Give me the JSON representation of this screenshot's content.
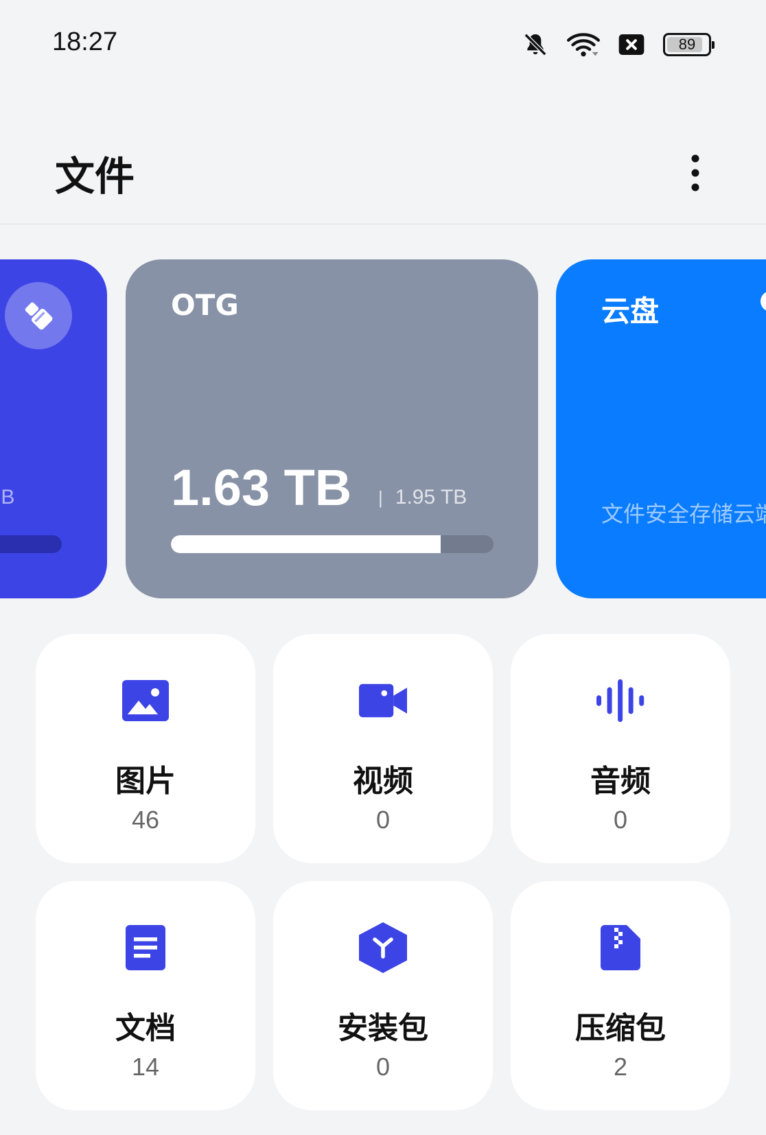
{
  "status_bar": {
    "time": "18:27",
    "battery": "89",
    "battery_level": 0.89,
    "icons": [
      "bell-off-icon",
      "wifi-icon",
      "no-sim-icon",
      "battery-icon"
    ]
  },
  "header": {
    "title": "文件",
    "more_icon": "more-vertical-icon"
  },
  "storage": {
    "internal": {
      "size_fragment": "GB",
      "cleanup_icon": "broom-icon"
    },
    "otg": {
      "title": "OTG",
      "used": "1.63 TB",
      "separator": "|",
      "total": "1.95 TB",
      "usage_fraction": 0.836
    },
    "cloud": {
      "title": "云盘",
      "description": "文件安全存储云端"
    }
  },
  "categories": [
    {
      "label": "图片",
      "count": "46",
      "icon": "image-icon"
    },
    {
      "label": "视频",
      "count": "0",
      "icon": "video-icon"
    },
    {
      "label": "音频",
      "count": "0",
      "icon": "audio-wave-icon"
    },
    {
      "label": "文档",
      "count": "14",
      "icon": "document-icon"
    },
    {
      "label": "安装包",
      "count": "0",
      "icon": "package-icon"
    },
    {
      "label": "压缩包",
      "count": "2",
      "icon": "zip-file-icon"
    }
  ],
  "colors": {
    "accent": "#3d44e6",
    "otg_card": "#8892a6",
    "cloud_card": "#0a7cff",
    "background": "#f3f4f6"
  }
}
